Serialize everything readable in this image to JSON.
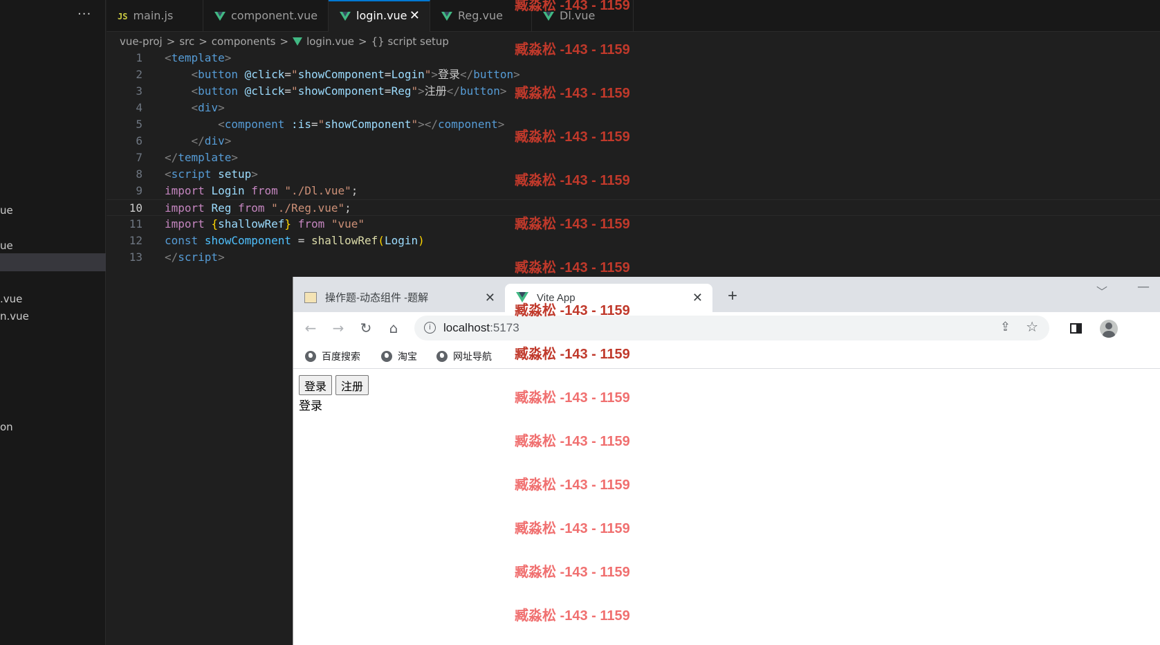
{
  "sidebar": {
    "more_label": "···",
    "items": [
      {
        "label": "ue"
      },
      {
        "label": "ue"
      },
      {
        "label": ""
      },
      {
        "label": ".vue"
      },
      {
        "label": "n.vue"
      },
      {
        "label": "on"
      }
    ]
  },
  "tabs": [
    {
      "label": "main.js",
      "icon_text": "JS"
    },
    {
      "label": "component.vue"
    },
    {
      "label": "login.vue",
      "close": "✕"
    },
    {
      "label": "Reg.vue"
    },
    {
      "label": "Dl.vue"
    }
  ],
  "breadcrumb": {
    "project": "vue-proj",
    "src": "src",
    "components": "components",
    "file": "login.vue",
    "symbol_icon": "{}",
    "symbol": "script setup",
    "separator": ">"
  },
  "editor": {
    "current_line": 10,
    "line_numbers": [
      "1",
      "2",
      "3",
      "4",
      "5",
      "6",
      "7",
      "8",
      "9",
      "10",
      "11",
      "12",
      "13"
    ]
  },
  "browser": {
    "tabs": [
      {
        "title": "操作题-动态组件 -题解",
        "close": "✕"
      },
      {
        "title": "Vite App",
        "close": "✕"
      }
    ],
    "new_tab": "+",
    "url_host": "localhost",
    "url_port": ":5173",
    "bookmarks": [
      "百度搜索",
      "淘宝",
      "网址导航"
    ],
    "page": {
      "buttons": [
        "登录",
        "注册"
      ],
      "component_text": "登录"
    }
  },
  "watermark": "臧淼松 -143 - 1159",
  "icons": {
    "back": "arrow-left-icon",
    "forward": "arrow-right-icon",
    "reload": "reload-icon",
    "home": "home-icon",
    "info": "info-icon",
    "share": "share-icon",
    "star": "star-icon",
    "side_panel": "side-panel-icon",
    "profile": "profile-icon",
    "globe": "globe-icon",
    "vue": "vue-logo-icon"
  },
  "colors": {
    "accent": "#0078d4",
    "vue_green": "#41b883",
    "watermark_dark": "#c0392b",
    "watermark_light": "#f07070"
  }
}
